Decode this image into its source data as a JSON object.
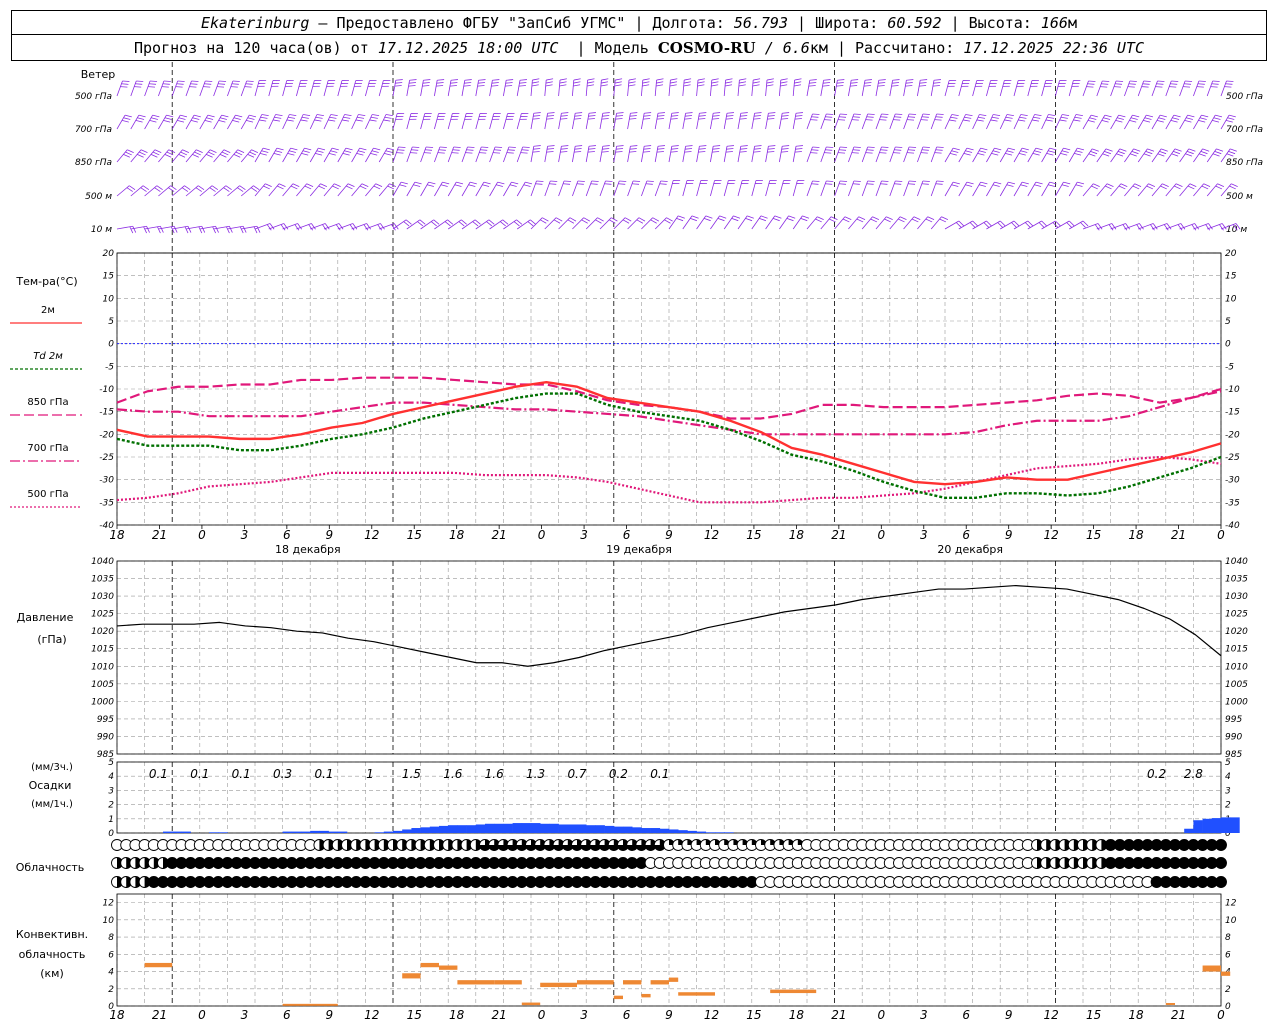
{
  "header": {
    "station": "Ekaterinburg",
    "provider": "– Предоставлено ФГБУ \"ЗапСиб УГМС\" |",
    "lon_label": "Долгота:",
    "lon_value": "56.793",
    "lat_label": "| Широта:",
    "lat_value": "60.592",
    "alt_label": "| Высота:",
    "alt_value": "166",
    "alt_unit": "м",
    "forecast_label": "Прогноз на 120 часа(ов) от",
    "forecast_date": "17.12.2025 18:00 UTC",
    "model_label": "| Модель",
    "model_name": "COSMO-RU",
    "model_res": "/ 6.6",
    "model_unit": "км",
    "calc_label": "| Рассчитано:",
    "calc_date": "17.12.2025 22:36 UTC"
  },
  "colors": {
    "wind": "#8a2be2",
    "t2m": "#ff3030",
    "td2m": "#007000",
    "t850": "#e0187a",
    "t700": "#e0187a",
    "t500": "#e0187a",
    "zero_line": "#2020ff",
    "pressure": "#000000",
    "precip": "#2050ff",
    "convective": "#ee8833",
    "grid": "#999999"
  },
  "chart_data": [
    {
      "type": "wind_barbs",
      "label": "Ветер",
      "levels": [
        "500 гПа",
        "700 гПа",
        "850 гПа",
        "500 м",
        "10  м"
      ]
    },
    {
      "type": "line",
      "ylabel": "Тем-ра(°C)",
      "ylim": [
        -40,
        20
      ],
      "yticks": [
        20,
        15,
        10,
        5,
        0,
        -5,
        -10,
        -15,
        -20,
        -25,
        -30,
        -35,
        -40
      ],
      "legend": [
        "2м",
        "Td  2м",
        "850 гПа",
        "700 гПа",
        "500 гПа"
      ],
      "x_hours": [
        0,
        3,
        6,
        9,
        12,
        15,
        18,
        21,
        24,
        27,
        30,
        33,
        36,
        39,
        42,
        45,
        48,
        51,
        54,
        57,
        60,
        63,
        66,
        69,
        72,
        75,
        78,
        81,
        84,
        87,
        90,
        93,
        96,
        99,
        102,
        105,
        108,
        111,
        114,
        117,
        120
      ],
      "series": [
        {
          "name": "2м",
          "values": [
            -19,
            -20.5,
            -20.5,
            -20.5,
            -21,
            -21,
            -20,
            -18.5,
            -17.5,
            -15.5,
            -14,
            -12.5,
            -11,
            -9.5,
            -8.5,
            -9.5,
            -12,
            -13,
            -14,
            -15,
            -17,
            -19.5,
            -23,
            -24.5,
            -26.5,
            -28.5,
            -30.5,
            -31,
            -30.5,
            -29.5,
            -30,
            -30,
            -28.5,
            -27,
            -25.5,
            -24,
            -22
          ]
        },
        {
          "name": "Td  2м",
          "values": [
            -21,
            -22.5,
            -22.5,
            -22.5,
            -23.5,
            -23.5,
            -22.5,
            -21,
            -20,
            -18.5,
            -16.5,
            -15,
            -13.5,
            -12,
            -11,
            -11,
            -13.5,
            -15,
            -16,
            -17,
            -19,
            -21.5,
            -24.5,
            -26,
            -28,
            -30.5,
            -32.5,
            -34,
            -34,
            -33,
            -33,
            -33.5,
            -33,
            -31.5,
            -29.5,
            -27.5,
            -25
          ]
        },
        {
          "name": "850 гПа",
          "values": [
            -13,
            -10.5,
            -9.5,
            -9.5,
            -9,
            -9,
            -8,
            -8,
            -7.5,
            -7.5,
            -7.5,
            -8,
            -8.5,
            -9,
            -9,
            -10.5,
            -12.5,
            -13.5,
            -14,
            -15,
            -16.5,
            -16.5,
            -15.5,
            -13.5,
            -13.5,
            -14,
            -14,
            -14,
            -13.5,
            -13,
            -12.5,
            -11.5,
            -11,
            -11.5,
            -13,
            -12,
            -10
          ]
        },
        {
          "name": "700 гПа",
          "values": [
            -14.5,
            -15,
            -15,
            -16,
            -16,
            -16,
            -16,
            -15,
            -14,
            -13,
            -13,
            -13.5,
            -14,
            -14.5,
            -14.5,
            -15,
            -15.5,
            -16,
            -17,
            -18,
            -19,
            -20,
            -20,
            -20,
            -20,
            -20,
            -20,
            -20,
            -19.5,
            -18,
            -17,
            -17,
            -17,
            -16,
            -14,
            -12,
            -10.5
          ]
        },
        {
          "name": "500 гПа",
          "values": [
            -34.5,
            -34,
            -33,
            -31.5,
            -31,
            -30.5,
            -29.5,
            -28.5,
            -28.5,
            -28.5,
            -28.5,
            -28.5,
            -29,
            -29,
            -29,
            -29.5,
            -30.5,
            -32,
            -33.5,
            -35,
            -35,
            -35,
            -34.5,
            -34,
            -34,
            -33.5,
            -33,
            -32,
            -30.5,
            -29,
            -27.5,
            -27,
            -26.5,
            -25.5,
            -25,
            -25.5,
            -26.5
          ]
        }
      ]
    },
    {
      "type": "line",
      "ylabel": "Давление",
      "yunit": "(гПа)",
      "ylim": [
        985,
        1040
      ],
      "yticks": [
        1040,
        1035,
        1030,
        1025,
        1020,
        1015,
        1010,
        1005,
        1000,
        995,
        990,
        985
      ],
      "series": [
        {
          "name": "",
          "values": [
            1021.5,
            1022,
            1022,
            1022,
            1022.5,
            1021.5,
            1021,
            1020,
            1019.5,
            1018,
            1017,
            1015.5,
            1014,
            1012.5,
            1011,
            1011,
            1010,
            1011,
            1012.5,
            1014.5,
            1016,
            1017.5,
            1019,
            1021,
            1022.5,
            1024,
            1025.5,
            1026.5,
            1027.5,
            1029,
            1030,
            1031,
            1032,
            1032,
            1032.5,
            1033,
            1032.5,
            1032,
            1030.5,
            1029,
            1026.5,
            1023.5,
            1019,
            1013
          ]
        }
      ]
    },
    {
      "type": "bar",
      "ylabel": "Осадки",
      "yunit_3h": "(мм/3ч.)",
      "yunit_1h": "(мм/1ч.)",
      "ylim": [
        0,
        5
      ],
      "yticks": [
        5,
        4,
        3,
        2,
        1,
        0
      ],
      "totals_3h": [
        "0.1",
        "0.1",
        "0.1",
        "0.3",
        "0.1",
        "1",
        "1.5",
        "1.6",
        "1.6",
        "1.3",
        "0.7",
        "0.2",
        "0.1",
        "0.2",
        "2.8"
      ],
      "hourly": [
        0,
        0,
        0,
        0,
        0,
        0.1,
        0.1,
        0.1,
        0,
        0,
        0.05,
        0.05,
        0,
        0,
        0,
        0,
        0,
        0,
        0.1,
        0.1,
        0.1,
        0.15,
        0.15,
        0.1,
        0.1,
        0,
        0,
        0,
        0.05,
        0.1,
        0.15,
        0.25,
        0.35,
        0.4,
        0.45,
        0.5,
        0.55,
        0.55,
        0.55,
        0.6,
        0.65,
        0.65,
        0.65,
        0.7,
        0.7,
        0.7,
        0.65,
        0.65,
        0.6,
        0.6,
        0.6,
        0.55,
        0.55,
        0.5,
        0.45,
        0.45,
        0.4,
        0.35,
        0.35,
        0.3,
        0.25,
        0.2,
        0.15,
        0.1,
        0.05,
        0.05,
        0.05,
        0,
        0,
        0,
        0,
        0,
        0,
        0,
        0,
        0,
        0,
        0,
        0,
        0,
        0,
        0,
        0,
        0,
        0,
        0,
        0,
        0,
        0,
        0,
        0,
        0,
        0,
        0,
        0,
        0,
        0,
        0,
        0,
        0,
        0,
        0,
        0,
        0,
        0,
        0,
        0,
        0,
        0,
        0,
        0,
        0,
        0,
        0,
        0,
        0,
        0.3,
        0.9,
        1.0,
        1.05,
        1.1,
        1.1
      ]
    },
    {
      "type": "symbols",
      "label": "Облачность"
    },
    {
      "type": "bar",
      "ylabel": "Конвективн.",
      "ylabel2": "облачность",
      "yunit": "(км)",
      "ylim": [
        0,
        13
      ],
      "yticks": [
        12,
        10,
        8,
        6,
        4,
        2,
        0
      ],
      "segments": [
        {
          "from": 3,
          "to": 6,
          "low": 4.5,
          "high": 5
        },
        {
          "from": 18,
          "to": 24,
          "low": 0.2,
          "high": 0.25
        },
        {
          "from": 31,
          "to": 33,
          "low": 3.2,
          "high": 3.8
        },
        {
          "from": 33,
          "to": 35,
          "low": 4.5,
          "high": 5
        },
        {
          "from": 35,
          "to": 37,
          "low": 4.2,
          "high": 4.7
        },
        {
          "from": 37,
          "to": 41,
          "low": 2.5,
          "high": 3
        },
        {
          "from": 41,
          "to": 44,
          "low": 2.5,
          "high": 3
        },
        {
          "from": 44,
          "to": 46,
          "low": 0.1,
          "high": 0.4
        },
        {
          "from": 46,
          "to": 50,
          "low": 2.2,
          "high": 2.7
        },
        {
          "from": 50,
          "to": 54,
          "low": 2.5,
          "high": 3
        },
        {
          "from": 54,
          "to": 55,
          "low": 0.8,
          "high": 1.2
        },
        {
          "from": 55,
          "to": 57,
          "low": 2.5,
          "high": 3
        },
        {
          "from": 57,
          "to": 58,
          "low": 1.0,
          "high": 1.4
        },
        {
          "from": 58,
          "to": 60,
          "low": 2.5,
          "high": 3
        },
        {
          "from": 60,
          "to": 61,
          "low": 2.8,
          "high": 3.3
        },
        {
          "from": 61,
          "to": 65,
          "low": 1.2,
          "high": 1.6
        },
        {
          "from": 71,
          "to": 76,
          "low": 1.5,
          "high": 1.9
        },
        {
          "from": 114,
          "to": 115,
          "low": 0.2,
          "high": 0.35
        },
        {
          "from": 118,
          "to": 120,
          "low": 4,
          "high": 4.7
        },
        {
          "from": 120,
          "to": 121,
          "low": 3.5,
          "high": 4
        }
      ]
    }
  ],
  "axis": {
    "hour_labels": [
      "18",
      "21",
      "0",
      "3",
      "6",
      "9",
      "12",
      "15",
      "18",
      "21",
      "0",
      "3",
      "6",
      "9",
      "12",
      "15",
      "18",
      "21",
      "0",
      "3",
      "6",
      "9",
      "12",
      "15",
      "18",
      "21",
      "0"
    ],
    "days": [
      "18 декабря",
      "19 декабря",
      "20 декабря"
    ]
  }
}
